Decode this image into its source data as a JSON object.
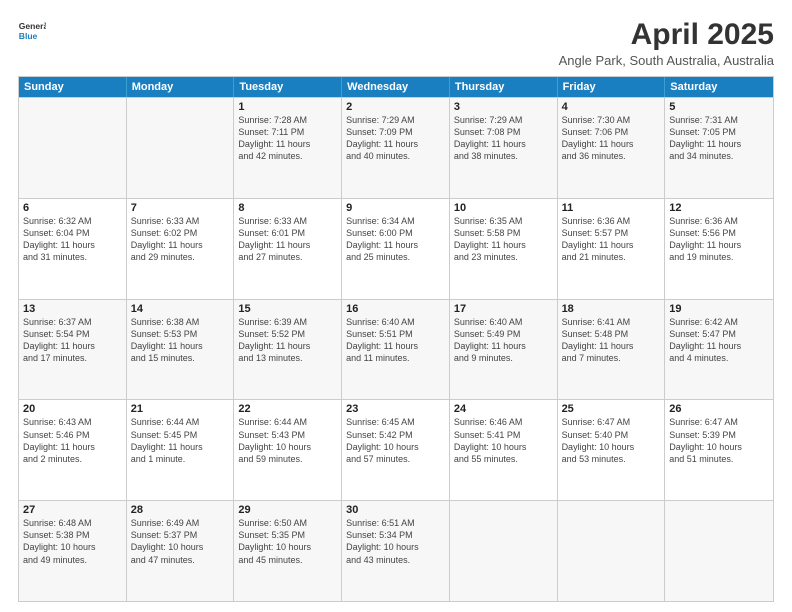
{
  "logo": {
    "line1": "General",
    "line2": "Blue"
  },
  "title": "April 2025",
  "subtitle": "Angle Park, South Australia, Australia",
  "headers": [
    "Sunday",
    "Monday",
    "Tuesday",
    "Wednesday",
    "Thursday",
    "Friday",
    "Saturday"
  ],
  "rows": [
    [
      {
        "day": "",
        "info": ""
      },
      {
        "day": "",
        "info": ""
      },
      {
        "day": "1",
        "info": "Sunrise: 7:28 AM\nSunset: 7:11 PM\nDaylight: 11 hours\nand 42 minutes."
      },
      {
        "day": "2",
        "info": "Sunrise: 7:29 AM\nSunset: 7:09 PM\nDaylight: 11 hours\nand 40 minutes."
      },
      {
        "day": "3",
        "info": "Sunrise: 7:29 AM\nSunset: 7:08 PM\nDaylight: 11 hours\nand 38 minutes."
      },
      {
        "day": "4",
        "info": "Sunrise: 7:30 AM\nSunset: 7:06 PM\nDaylight: 11 hours\nand 36 minutes."
      },
      {
        "day": "5",
        "info": "Sunrise: 7:31 AM\nSunset: 7:05 PM\nDaylight: 11 hours\nand 34 minutes."
      }
    ],
    [
      {
        "day": "6",
        "info": "Sunrise: 6:32 AM\nSunset: 6:04 PM\nDaylight: 11 hours\nand 31 minutes."
      },
      {
        "day": "7",
        "info": "Sunrise: 6:33 AM\nSunset: 6:02 PM\nDaylight: 11 hours\nand 29 minutes."
      },
      {
        "day": "8",
        "info": "Sunrise: 6:33 AM\nSunset: 6:01 PM\nDaylight: 11 hours\nand 27 minutes."
      },
      {
        "day": "9",
        "info": "Sunrise: 6:34 AM\nSunset: 6:00 PM\nDaylight: 11 hours\nand 25 minutes."
      },
      {
        "day": "10",
        "info": "Sunrise: 6:35 AM\nSunset: 5:58 PM\nDaylight: 11 hours\nand 23 minutes."
      },
      {
        "day": "11",
        "info": "Sunrise: 6:36 AM\nSunset: 5:57 PM\nDaylight: 11 hours\nand 21 minutes."
      },
      {
        "day": "12",
        "info": "Sunrise: 6:36 AM\nSunset: 5:56 PM\nDaylight: 11 hours\nand 19 minutes."
      }
    ],
    [
      {
        "day": "13",
        "info": "Sunrise: 6:37 AM\nSunset: 5:54 PM\nDaylight: 11 hours\nand 17 minutes."
      },
      {
        "day": "14",
        "info": "Sunrise: 6:38 AM\nSunset: 5:53 PM\nDaylight: 11 hours\nand 15 minutes."
      },
      {
        "day": "15",
        "info": "Sunrise: 6:39 AM\nSunset: 5:52 PM\nDaylight: 11 hours\nand 13 minutes."
      },
      {
        "day": "16",
        "info": "Sunrise: 6:40 AM\nSunset: 5:51 PM\nDaylight: 11 hours\nand 11 minutes."
      },
      {
        "day": "17",
        "info": "Sunrise: 6:40 AM\nSunset: 5:49 PM\nDaylight: 11 hours\nand 9 minutes."
      },
      {
        "day": "18",
        "info": "Sunrise: 6:41 AM\nSunset: 5:48 PM\nDaylight: 11 hours\nand 7 minutes."
      },
      {
        "day": "19",
        "info": "Sunrise: 6:42 AM\nSunset: 5:47 PM\nDaylight: 11 hours\nand 4 minutes."
      }
    ],
    [
      {
        "day": "20",
        "info": "Sunrise: 6:43 AM\nSunset: 5:46 PM\nDaylight: 11 hours\nand 2 minutes."
      },
      {
        "day": "21",
        "info": "Sunrise: 6:44 AM\nSunset: 5:45 PM\nDaylight: 11 hours\nand 1 minute."
      },
      {
        "day": "22",
        "info": "Sunrise: 6:44 AM\nSunset: 5:43 PM\nDaylight: 10 hours\nand 59 minutes."
      },
      {
        "day": "23",
        "info": "Sunrise: 6:45 AM\nSunset: 5:42 PM\nDaylight: 10 hours\nand 57 minutes."
      },
      {
        "day": "24",
        "info": "Sunrise: 6:46 AM\nSunset: 5:41 PM\nDaylight: 10 hours\nand 55 minutes."
      },
      {
        "day": "25",
        "info": "Sunrise: 6:47 AM\nSunset: 5:40 PM\nDaylight: 10 hours\nand 53 minutes."
      },
      {
        "day": "26",
        "info": "Sunrise: 6:47 AM\nSunset: 5:39 PM\nDaylight: 10 hours\nand 51 minutes."
      }
    ],
    [
      {
        "day": "27",
        "info": "Sunrise: 6:48 AM\nSunset: 5:38 PM\nDaylight: 10 hours\nand 49 minutes."
      },
      {
        "day": "28",
        "info": "Sunrise: 6:49 AM\nSunset: 5:37 PM\nDaylight: 10 hours\nand 47 minutes."
      },
      {
        "day": "29",
        "info": "Sunrise: 6:50 AM\nSunset: 5:35 PM\nDaylight: 10 hours\nand 45 minutes."
      },
      {
        "day": "30",
        "info": "Sunrise: 6:51 AM\nSunset: 5:34 PM\nDaylight: 10 hours\nand 43 minutes."
      },
      {
        "day": "",
        "info": ""
      },
      {
        "day": "",
        "info": ""
      },
      {
        "day": "",
        "info": ""
      }
    ]
  ]
}
